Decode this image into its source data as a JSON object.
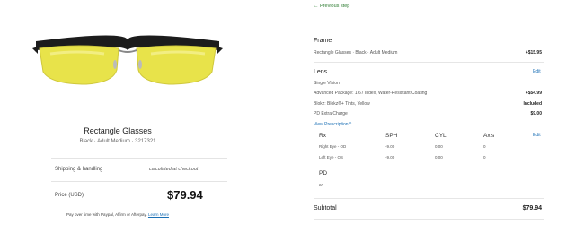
{
  "product": {
    "title": "Rectangle Glasses",
    "sku_line": "Black · Adult Medium · 3217321",
    "shipping_label": "Shipping & handling",
    "shipping_value": "calculated at checkout",
    "price_label": "Price (USD)",
    "price_value": "$79.94",
    "pay_note": "Pay over time with Paypal, Affirm or Afterpay.",
    "learn_more": "Learn More"
  },
  "nav": {
    "previous_step": "Previous step"
  },
  "frame": {
    "heading": "Frame",
    "item": "Rectangle Glasses · Black · Adult Medium",
    "item_price": "+$15.95"
  },
  "lens": {
    "heading": "Lens",
    "edit_label": "Edit",
    "rows": [
      {
        "label": "Single Vision",
        "price": ""
      },
      {
        "label": "Advanced Package: 1.67 Index, Water-Resistant Coating",
        "price": "+$54.99"
      },
      {
        "label": "Blokz: Blokz®+ Tints, Yellow",
        "price": "Included"
      },
      {
        "label": "PD Extra Charge",
        "price": "$9.00"
      }
    ],
    "view_prescription": "View Prescription ^"
  },
  "prescription": {
    "edit_label": "Edit",
    "headers": [
      "Rx",
      "SPH",
      "CYL",
      "Axis"
    ],
    "rows": [
      [
        "Right Eye - OD",
        "-9.00",
        "0.00",
        "0"
      ],
      [
        "Left Eye - OS",
        "-9.00",
        "0.00",
        "0"
      ]
    ],
    "pd_label": "PD",
    "pd_value": "60"
  },
  "summary": {
    "subtotal_label": "Subtotal",
    "subtotal_value": "$79.94"
  },
  "colors": {
    "link": "#1a6fb5",
    "previous_step": "#2e7d32",
    "lens_tint": "#e8e34a",
    "frame": "#1c1c1c"
  },
  "icons": {
    "previous_step": "arrow-left-icon",
    "view_prescription": "chevron-up-icon"
  }
}
